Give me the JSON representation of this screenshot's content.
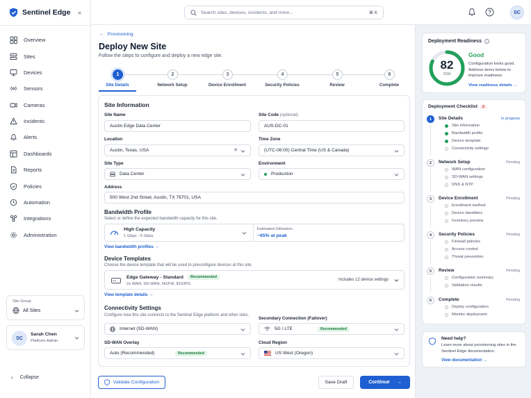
{
  "app": {
    "name": "Sentinel Edge"
  },
  "search": {
    "placeholder": "Search sites, devices, incidents, and more...",
    "shortcut": "⌘ K"
  },
  "user": {
    "initials": "SC",
    "name": "Sarah Chen",
    "role": "Platform Admin"
  },
  "nav": [
    {
      "label": "Overview",
      "icon": "grid-icon"
    },
    {
      "label": "Sites",
      "icon": "sites-icon"
    },
    {
      "label": "Devices",
      "icon": "monitor-icon"
    },
    {
      "label": "Sensors",
      "icon": "sensor-icon"
    },
    {
      "label": "Cameras",
      "icon": "camera-icon"
    },
    {
      "label": "Incidents",
      "icon": "incident-icon"
    },
    {
      "label": "Alerts",
      "icon": "alert-icon"
    },
    {
      "label": "Dashboards",
      "icon": "dashboard-icon"
    },
    {
      "label": "Reports",
      "icon": "report-icon"
    },
    {
      "label": "Policies",
      "icon": "shield-icon"
    },
    {
      "label": "Automation",
      "icon": "automation-icon"
    },
    {
      "label": "Integrations",
      "icon": "integrations-icon"
    },
    {
      "label": "Administration",
      "icon": "gear-icon"
    }
  ],
  "site_group": {
    "label": "Site Group",
    "value": "All Sites"
  },
  "collapse_label": "Collapse",
  "page": {
    "breadcrumb": "Provisioning",
    "title": "Deploy New Site",
    "subtitle": "Follow the steps to configure and deploy a new edge site."
  },
  "steps": [
    {
      "num": "1",
      "label": "Site Details",
      "active": true
    },
    {
      "num": "2",
      "label": "Network Setup"
    },
    {
      "num": "3",
      "label": "Device Enrollment"
    },
    {
      "num": "4",
      "label": "Security Policies"
    },
    {
      "num": "5",
      "label": "Review"
    },
    {
      "num": "6",
      "label": "Complete"
    }
  ],
  "site_info": {
    "heading": "Site Information",
    "site_name_label": "Site Name",
    "site_name": "Austin Edge Data Center",
    "site_code_label": "Site Code",
    "site_code_optional": "(optional)",
    "site_code": "AUS-DC-01",
    "location_label": "Location",
    "location": "Austin, Texas, USA",
    "timezone_label": "Time Zone",
    "timezone": "(UTC-06:00) Central Time (US & Canada)",
    "site_type_label": "Site Type",
    "site_type": "Data Center",
    "environment_label": "Environment",
    "environment": "Production",
    "address_label": "Address",
    "address": "500 West 2nd Street, Austin, TX 78701, USA"
  },
  "bandwidth": {
    "heading": "Bandwidth Profile",
    "sub": "Select or define the expected bandwidth capacity for this site.",
    "name": "High Capacity",
    "range": "1 Gbps - 5 Gbps",
    "est_label": "Estimated Utilization",
    "est_value": "~65% at peak",
    "link": "View bandwidth profiles"
  },
  "templates": {
    "heading": "Device Templates",
    "sub": "Choose the device template that will be used to preconfigure devices at this site.",
    "name": "Edge Gateway - Standard",
    "badge": "Recommended",
    "features": "2x WAN, SD-WAN, NGFW, IDS/IPS",
    "includes": "Includes 12 device settings",
    "link": "View template details"
  },
  "connectivity": {
    "heading": "Connectivity Settings",
    "sub": "Configure how this site connects to the Sentinel Edge platform and other sites.",
    "primary": "Internet (SD-WAN)",
    "secondary_label": "Secondary Connection (Failover)",
    "secondary": "5G / LTE",
    "secondary_badge": "Recommended",
    "overlay_label": "SD-WAN Overlay",
    "overlay": "Auto (Recommended)",
    "overlay_badge": "Recommended",
    "region_label": "Cloud Region",
    "region": "US West (Oregon)"
  },
  "actions": {
    "validate": "Validate Configuration",
    "save": "Save Draft",
    "continue": "Continue"
  },
  "readiness": {
    "title": "Deployment Readiness",
    "score": 82,
    "max": "/100",
    "status": "Good",
    "desc": "Configuration looks good. Address items below to improve readiness.",
    "link": "View readiness details",
    "color": "#22a05a"
  },
  "checklist": {
    "title": "Deployment Checklist",
    "count": "2",
    "sections": [
      {
        "num": "1",
        "title": "Site Details",
        "status": "In progress",
        "items": [
          "Site information",
          "Bandwidth profile",
          "Device template",
          "Connectivity settings"
        ],
        "done": [
          true,
          true,
          true,
          false
        ]
      },
      {
        "num": "2",
        "title": "Network Setup",
        "status": "Pending",
        "items": [
          "WAN configuration",
          "SD-WAN settings",
          "DNS & NTP"
        ]
      },
      {
        "num": "3",
        "title": "Device Enrollment",
        "status": "Pending",
        "items": [
          "Enrollment method",
          "Device identifiers",
          "Inventory preview"
        ]
      },
      {
        "num": "4",
        "title": "Security Policies",
        "status": "Pending",
        "items": [
          "Firewall policies",
          "Access control",
          "Threat prevention"
        ]
      },
      {
        "num": "5",
        "title": "Review",
        "status": "Pending",
        "items": [
          "Configuration summary",
          "Validation results"
        ]
      },
      {
        "num": "6",
        "title": "Complete",
        "status": "Pending",
        "items": [
          "Deploy configuration",
          "Monitor deployment"
        ]
      }
    ]
  },
  "help": {
    "title": "Need help?",
    "desc": "Learn more about provisioning sites in the Sentinel Edge documentation.",
    "link": "View documentation"
  }
}
